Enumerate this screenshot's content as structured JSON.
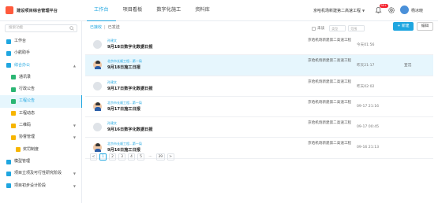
{
  "app": {
    "title": "建设项目综合管理平台"
  },
  "header": {
    "tabs": [
      "工作台",
      "项目看板",
      "数字化施工",
      "资料库"
    ],
    "active_tab": 0,
    "project_name": "京哈机场新建第二高速工程",
    "notification_badge": "99+",
    "username": "杨冰晓"
  },
  "sidebar": {
    "search_placeholder": "搜索功能",
    "items": [
      {
        "label": "工作台",
        "level": 0,
        "icon": "desk-icon",
        "color": "#1fa6e0"
      },
      {
        "label": "小航助手",
        "level": 0,
        "icon": "assistant-icon",
        "color": "#1fa6e0"
      },
      {
        "label": "综合办公",
        "level": 0,
        "icon": "office-icon",
        "color": "#1fa6e0",
        "expanded": true
      },
      {
        "label": "通讯录",
        "level": 1,
        "icon": "contacts-icon",
        "color": "#2bb673"
      },
      {
        "label": "行政公告",
        "level": 1,
        "icon": "notice-icon",
        "color": "#2bb673"
      },
      {
        "label": "工程公告",
        "level": 1,
        "icon": "announcement-icon",
        "color": "#2bb673",
        "active": true
      },
      {
        "label": "工程动态",
        "level": 1,
        "icon": "news-icon",
        "color": "#f7b500"
      },
      {
        "label": "二维码",
        "level": 1,
        "icon": "qrcode-icon",
        "color": "#f7b500",
        "has_children": true
      },
      {
        "label": "协督管理",
        "level": 1,
        "icon": "supervise-icon",
        "color": "#f7b500",
        "has_children": true
      },
      {
        "label": "奖罚制度",
        "level": 2,
        "icon": "rules-icon",
        "color": "#f7b500"
      },
      {
        "label": "模型管理",
        "level": 0,
        "icon": "model-icon",
        "color": "#1fa6e0"
      },
      {
        "label": "项目立项及可行性研究阶段",
        "level": 0,
        "icon": "project-icon",
        "color": "#1fa6e0",
        "has_children": true
      },
      {
        "label": "项目初步设计阶段",
        "level": 0,
        "icon": "design-icon",
        "color": "#1fa6e0",
        "has_children": true
      }
    ]
  },
  "main": {
    "breadcrumb": {
      "parent": "已接收",
      "current": "已发送"
    },
    "filters": {
      "unread_label": "未读",
      "type_placeholder": "类型",
      "range_placeholder": "范围"
    },
    "new_button": "+ 新建",
    "edit_button": "编辑",
    "rows": [
      {
        "author": "孙建文",
        "title": "9月18日数字化数据日报",
        "org": "京哈机场新建第二高速工程",
        "time": "今天01:56",
        "link": "",
        "avatar": "blank",
        "highlight": false
      },
      {
        "author": "北京市长顺工程...第一局",
        "title": "9月18日施工日报",
        "org": "京哈机场新建第二高速工程",
        "time": "昨天21:17",
        "link": "宣沉",
        "avatar": "person",
        "highlight": true
      },
      {
        "author": "孙建文",
        "title": "9月17日数字化数据日报",
        "org": "京哈机场新建第二高速工程",
        "time": "昨天02:02",
        "link": "",
        "avatar": "blank",
        "highlight": false
      },
      {
        "author": "北京市长顺工程...第一局",
        "title": "9月17日施工日报",
        "org": "京哈机场新建第二高速工程",
        "time": "09-17 21:16",
        "link": "",
        "avatar": "person",
        "highlight": false
      },
      {
        "author": "孙建文",
        "title": "9月16日数字化数据日报",
        "org": "京哈机场新建第二高速工程",
        "time": "09-17 00:45",
        "link": "",
        "avatar": "blank",
        "highlight": false
      },
      {
        "author": "北京市长顺工程...第一局",
        "title": "9月16日施工日报",
        "org": "京哈机场新建第二高速工程",
        "time": "09-16 21:13",
        "link": "",
        "avatar": "person",
        "highlight": false
      }
    ],
    "pagination": {
      "pages": [
        "<",
        "1",
        "2",
        "3",
        "4",
        "5",
        "...",
        "39",
        ">"
      ],
      "current": "1"
    }
  }
}
